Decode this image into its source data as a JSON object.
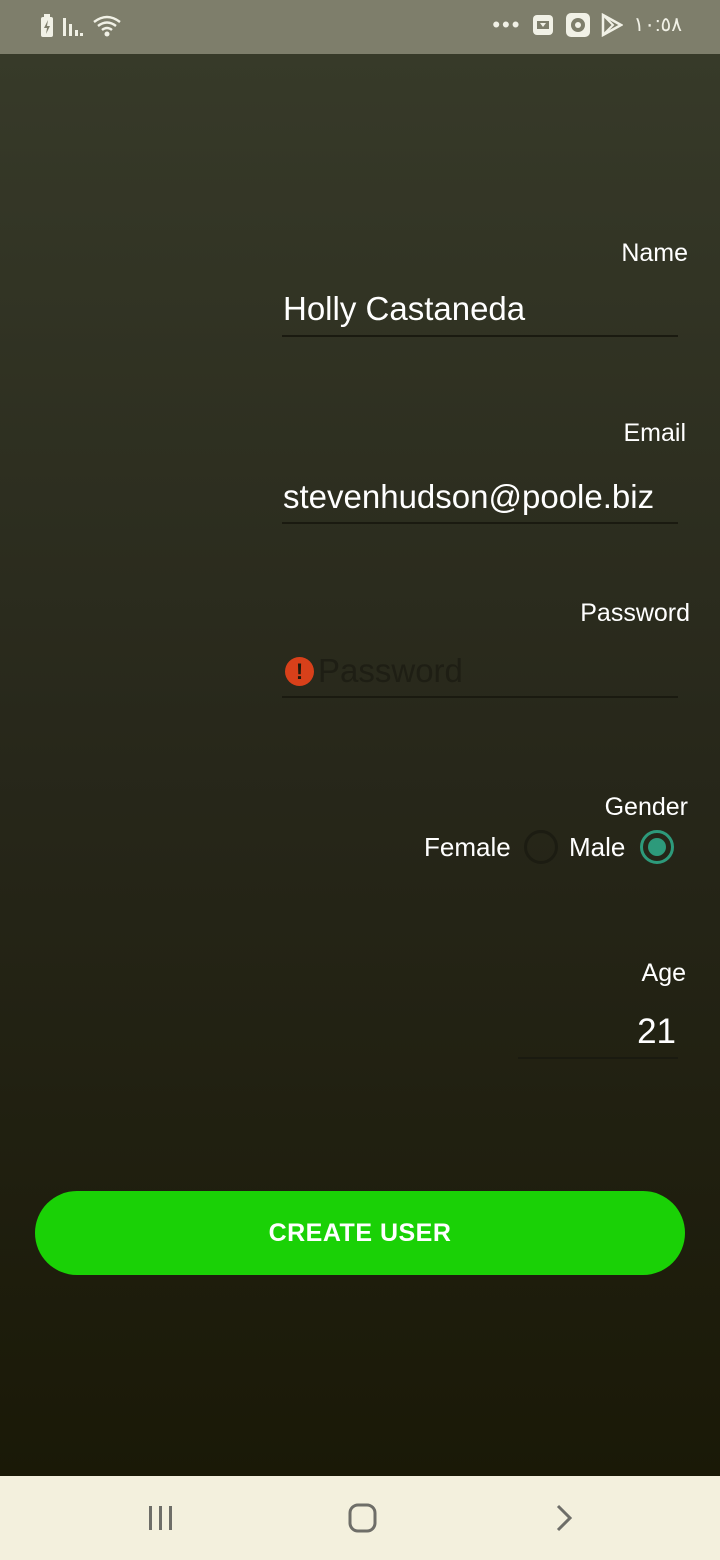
{
  "status_bar": {
    "time": "١٠:٥٨",
    "overflow_dots": "•••",
    "left_icons": [
      "battery-charging-icon",
      "signal-icon",
      "wifi-icon"
    ],
    "right_icons": [
      "download-icon",
      "notification-icon",
      "play-store-icon"
    ]
  },
  "form": {
    "name": {
      "label": "Name",
      "value": "Holly Castaneda"
    },
    "email": {
      "label": "Email",
      "value": "stevenhudson@poole.biz"
    },
    "password": {
      "label": "Password",
      "placeholder": "Password",
      "error_icon": "!"
    },
    "gender": {
      "label": "Gender",
      "options": [
        {
          "label": "Female",
          "checked": false
        },
        {
          "label": "Male",
          "checked": true
        }
      ]
    },
    "age": {
      "label": "Age",
      "value": "21"
    }
  },
  "actions": {
    "create_user_label": "CREATE USER"
  },
  "nav_bar": {
    "icons": [
      "recents-icon",
      "home-icon",
      "back-icon"
    ]
  },
  "colors": {
    "status_bar_bg": "#7e7e6b",
    "accent_button": "#1ad106",
    "radio_checked": "#2d9a7b",
    "error": "#d8401a",
    "nav_bar_bg": "#f3f0dd"
  }
}
